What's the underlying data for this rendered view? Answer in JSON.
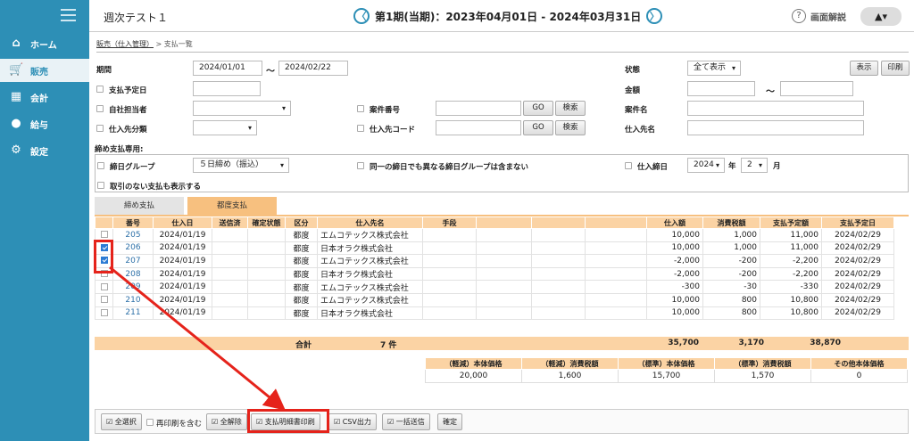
{
  "sidebar": {
    "items": [
      {
        "label": "ホーム",
        "icon": "home-icon"
      },
      {
        "label": "販売",
        "icon": "cart-icon"
      },
      {
        "label": "会計",
        "icon": "calculator-icon"
      },
      {
        "label": "給与",
        "icon": "money-bag-icon"
      },
      {
        "label": "設定",
        "icon": "gear-icon"
      }
    ]
  },
  "header": {
    "title": "週次テスト１",
    "period": "第1期(当期)：2023年04月01日 - 2024年03月31日",
    "prev": "〈",
    "next": "〉",
    "help": "画面解説",
    "help_mark": "?",
    "user": "▲▾"
  },
  "breadcrumb": {
    "parent": "販売（仕入管理）",
    "sep": ">",
    "current": "支払一覧"
  },
  "form": {
    "period_label": "期間",
    "period_from": "2024/01/01",
    "period_tilde": "〜",
    "period_to": "2024/02/22",
    "status_label": "状態",
    "status_value": "全て表示",
    "show_btn": "表示",
    "print_btn": "印刷",
    "due_label": "支払予定日",
    "amount_label": "金額",
    "amount_tilde": "〜",
    "staff_label": "自社担当者",
    "case_no_label": "案件番号",
    "go": "GO",
    "search": "検索",
    "case_name_label": "案件名",
    "vendor_class_label": "仕入先分類",
    "vendor_code_label": "仕入先コード",
    "vendor_name_label": "仕入先名",
    "closing_only": "締め支払専用:",
    "closing_group_label": "締日グループ",
    "closing_group_value": "５日締め（振込）",
    "exclude_label": "同一の締日でも異なる締日グループは含まない",
    "closing_date_label": "仕入締日",
    "year": "2024",
    "year_unit": "年",
    "month": "2",
    "month_unit": "月",
    "no_trade_label": "取引のない支払も表示する"
  },
  "tabs": [
    "締め支払",
    "都度支払"
  ],
  "table": {
    "headers": [
      "",
      "番号",
      "仕入日",
      "送信済",
      "確定状態",
      "区分",
      "仕入先名",
      "手段",
      "",
      "",
      "",
      "仕入額",
      "消費税額",
      "支払予定額",
      "支払予定日"
    ],
    "rows": [
      {
        "checked": false,
        "no": "205",
        "date": "2024/01/19",
        "kubun": "都度",
        "vendor": "エムコテックス株式会社",
        "amount": "10,000",
        "tax": "1,000",
        "pay": "11,000",
        "due": "2024/02/29"
      },
      {
        "checked": true,
        "no": "206",
        "date": "2024/01/19",
        "kubun": "都度",
        "vendor": "日本オラク株式会社",
        "amount": "10,000",
        "tax": "1,000",
        "pay": "11,000",
        "due": "2024/02/29"
      },
      {
        "checked": true,
        "no": "207",
        "date": "2024/01/19",
        "kubun": "都度",
        "vendor": "エムコテックス株式会社",
        "amount": "-2,000",
        "tax": "-200",
        "pay": "-2,200",
        "due": "2024/02/29"
      },
      {
        "checked": false,
        "no": "208",
        "date": "2024/01/19",
        "kubun": "都度",
        "vendor": "日本オラク株式会社",
        "amount": "-2,000",
        "tax": "-200",
        "pay": "-2,200",
        "due": "2024/02/29"
      },
      {
        "checked": false,
        "no": "209",
        "date": "2024/01/19",
        "kubun": "都度",
        "vendor": "エムコテックス株式会社",
        "amount": "-300",
        "tax": "-30",
        "pay": "-330",
        "due": "2024/02/29"
      },
      {
        "checked": false,
        "no": "210",
        "date": "2024/01/19",
        "kubun": "都度",
        "vendor": "エムコテックス株式会社",
        "amount": "10,000",
        "tax": "800",
        "pay": "10,800",
        "due": "2024/02/29"
      },
      {
        "checked": false,
        "no": "211",
        "date": "2024/01/19",
        "kubun": "都度",
        "vendor": "日本オラク株式会社",
        "amount": "10,000",
        "tax": "800",
        "pay": "10,800",
        "due": "2024/02/29"
      }
    ]
  },
  "totals": {
    "label": "合計",
    "count": "7 件",
    "amount": "35,700",
    "tax": "3,170",
    "pay": "38,870"
  },
  "summary": {
    "headers": [
      "（軽減）本体価格",
      "（軽減）消費税額",
      "（標準）本体価格",
      "（標準）消費税額",
      "その他本体価格"
    ],
    "values": [
      "20,000",
      "1,600",
      "15,700",
      "1,570",
      "0"
    ]
  },
  "footer": {
    "select_all": "全選択",
    "reprint": "再印刷を含む",
    "deselect": "全解除",
    "print_detail": "支払明細書印刷",
    "csv": "CSV出力",
    "bulk_send": "一括送信",
    "confirm": "確定",
    "check_mark": "☑"
  },
  "colors": {
    "sidebar": "#2d8fb6",
    "table_header": "#fbd3a4",
    "highlight": "#e5231b"
  }
}
